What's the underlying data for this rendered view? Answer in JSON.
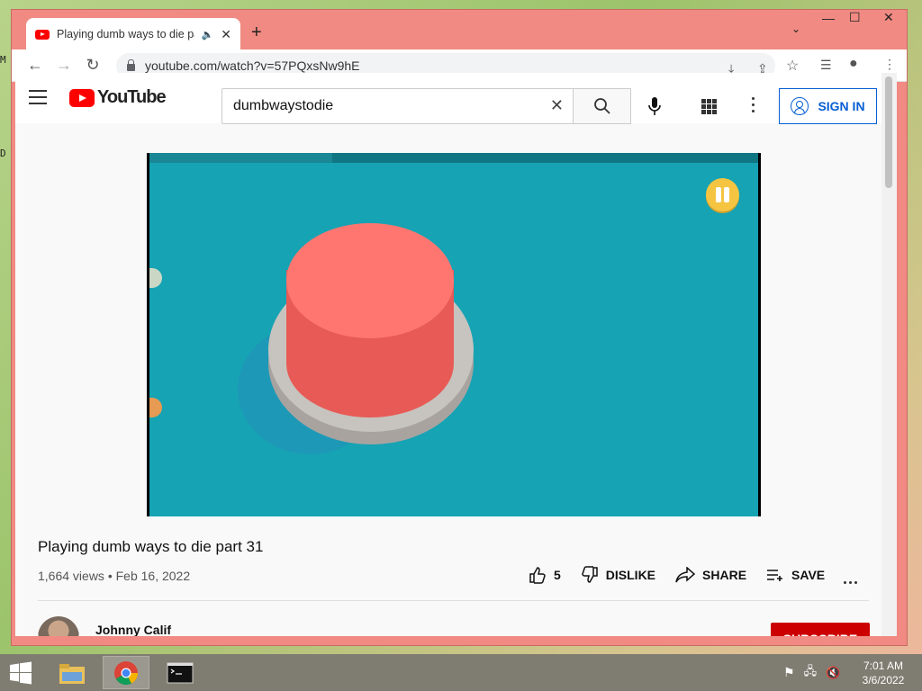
{
  "desktop": {
    "edge_letters": [
      "M",
      "D"
    ]
  },
  "browser": {
    "tab_title": "Playing dumb ways to die pa",
    "url": "youtube.com/watch?v=57PQxsNw9hE"
  },
  "youtube": {
    "logo_text": "YouTube",
    "search_value": "dumbwaystodie",
    "signin_label": "SIGN IN",
    "player": {
      "progress_fraction": 0.3
    },
    "video": {
      "title": "Playing dumb ways to die part 31",
      "meta": "1,664 views • Feb 16, 2022",
      "like_count": "5",
      "dislike_label": "DISLIKE",
      "share_label": "SHARE",
      "save_label": "SAVE"
    },
    "channel": {
      "name": "Johnny Calif",
      "subscribe_label": "SUBSCRIBE"
    }
  },
  "taskbar": {
    "items": [
      "file-explorer",
      "chrome",
      "command-prompt"
    ],
    "time": "7:01 AM",
    "date": "3/6/2022"
  },
  "colors": {
    "accent": "#065fd4",
    "window_frame": "#f08a82",
    "subscribe": "#cc0000"
  }
}
